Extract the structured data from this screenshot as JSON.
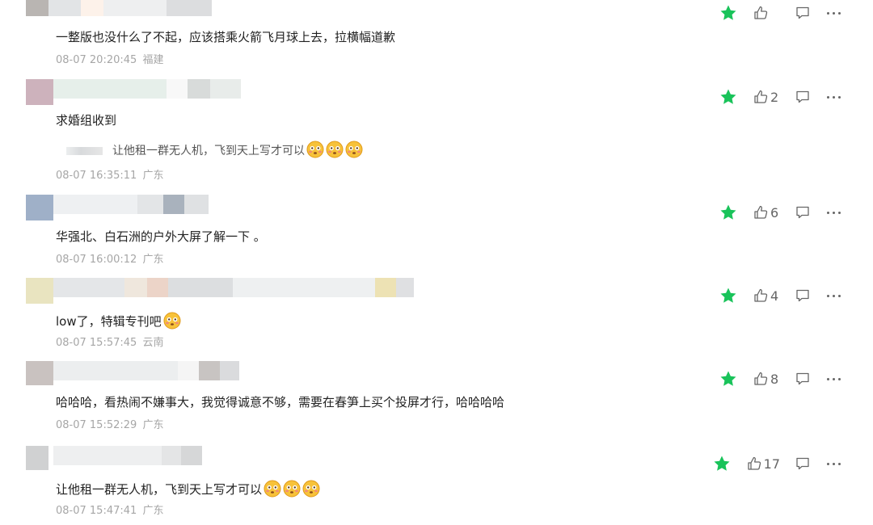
{
  "colors": {
    "accent": "#19c35a",
    "meta": "#a6a6a6",
    "icon": "#666666"
  },
  "comments": [
    {
      "text": "一整版也没什么了不起，应该搭乘火箭飞月球上去，拉横幅道歉",
      "time": "08-07 20:20:45",
      "location": "福建",
      "likes": "",
      "emoji_count": 0,
      "reply": null
    },
    {
      "text": "求婚组收到",
      "time": "08-07 16:35:11",
      "location": "广东",
      "likes": "2",
      "emoji_count": 0,
      "reply": {
        "text": "让他租一群无人机，飞到天上写才可以",
        "emoji_count": 3
      }
    },
    {
      "text": "华强北、白石洲的户外大屏了解一下 。",
      "time": "08-07 16:00:12",
      "location": "广东",
      "likes": "6",
      "emoji_count": 0,
      "reply": null
    },
    {
      "text": "low了，特辑专刊吧",
      "time": "08-07 15:57:45",
      "location": "云南",
      "likes": "4",
      "emoji_count": 1,
      "reply": null
    },
    {
      "text": "哈哈哈，看热闹不嫌事大，我觉得诚意不够，需要在春笋上买个投屏才行，哈哈哈哈",
      "time": "08-07 15:52:29",
      "location": "广东",
      "likes": "8",
      "emoji_count": 0,
      "reply": null
    },
    {
      "text": "让他租一群无人机，飞到天上写才可以",
      "time": "08-07 15:47:41",
      "location": "广东",
      "likes": "17",
      "emoji_count": 3,
      "reply": null
    }
  ],
  "icons": {
    "star": "star-icon",
    "like": "thumbs-up-icon",
    "reply": "comment-bubble-icon",
    "more": "more-dots-icon",
    "emoji": "flushed-face-emoji"
  }
}
